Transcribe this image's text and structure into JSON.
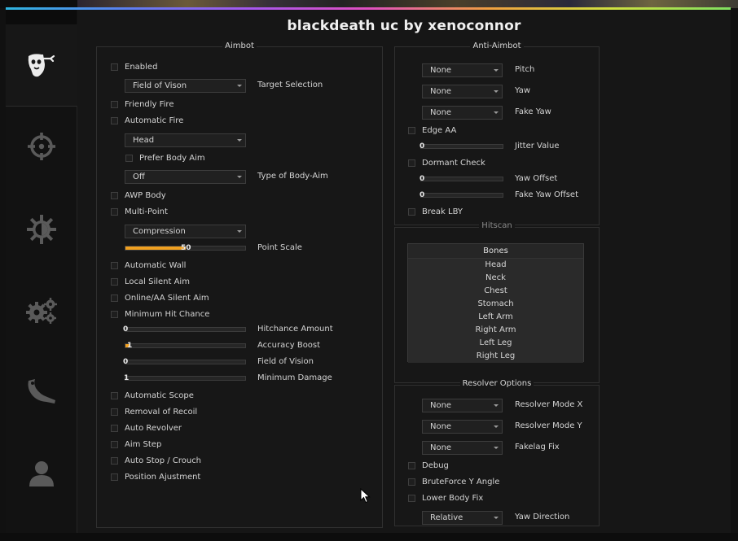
{
  "window": {
    "title": "blackdeath uc by xenoconnor"
  },
  "sidebar": {
    "items": [
      {
        "icon": "ghost-face-icon",
        "active": true
      },
      {
        "icon": "crosshair-icon"
      },
      {
        "icon": "brightness-icon"
      },
      {
        "icon": "gears-icon"
      },
      {
        "icon": "knife-icon"
      },
      {
        "icon": "user-icon"
      }
    ]
  },
  "aimbot": {
    "title": "Aimbot",
    "enabled": "Enabled",
    "target_selection": {
      "value": "Field of Vison",
      "label": "Target Selection"
    },
    "friendly_fire": "Friendly Fire",
    "automatic_fire": "Automatic Fire",
    "hitbox": {
      "value": "Head"
    },
    "prefer_body_aim": "Prefer Body Aim",
    "body_aim_type": {
      "value": "Off",
      "label": "Type of Body-Aim"
    },
    "awp_body": "AWP Body",
    "multi_point": "Multi-Point",
    "multipoint_mode": {
      "value": "Compression"
    },
    "point_scale": {
      "value": "50",
      "label": "Point Scale",
      "fraction": 0.5
    },
    "automatic_wall": "Automatic Wall",
    "local_silent_aim": "Local Silent Aim",
    "online_silent_aim": "Online/AA Silent Aim",
    "minimum_hit_chance": "Minimum Hit Chance",
    "hitchance_amount": {
      "value": "0",
      "label": "Hitchance Amount",
      "fraction": 0
    },
    "accuracy_boost": {
      "value": "1",
      "label": "Accuracy Boost",
      "fraction": 0.04
    },
    "field_of_vision": {
      "value": "0",
      "label": "Field of Vision",
      "fraction": 0
    },
    "minimum_damage": {
      "value": "1",
      "label": "Minimum Damage",
      "fraction": 0
    },
    "automatic_scope": "Automatic Scope",
    "removal_of_recoil": "Removal of Recoil",
    "auto_revolver": "Auto Revolver",
    "aim_step": "Aim Step",
    "auto_stop": "Auto Stop / Crouch",
    "position_adjustment": "Position Ajustment"
  },
  "anti_aimbot": {
    "title": "Anti-Aimbot",
    "pitch": {
      "value": "None",
      "label": "Pitch"
    },
    "yaw": {
      "value": "None",
      "label": "Yaw"
    },
    "fake_yaw": {
      "value": "None",
      "label": "Fake Yaw"
    },
    "edge_aa": "Edge AA",
    "jitter_value": {
      "value": "0",
      "label": "Jitter Value",
      "fraction": 0
    },
    "dormant_check": "Dormant Check",
    "yaw_offset": {
      "value": "0",
      "label": "Yaw Offset",
      "fraction": 0
    },
    "fake_yaw_offset": {
      "value": "0",
      "label": "Fake Yaw Offset",
      "fraction": 0
    },
    "break_lby": "Break LBY"
  },
  "hitscan": {
    "title": "Hitscan",
    "header": "Bones",
    "bones": [
      "Head",
      "Neck",
      "Chest",
      "Stomach",
      "Left Arm",
      "Right Arm",
      "Left Leg",
      "Right Leg"
    ]
  },
  "resolver": {
    "title": "Resolver Options",
    "mode_x": {
      "value": "None",
      "label": "Resolver Mode X"
    },
    "mode_y": {
      "value": "None",
      "label": "Resolver Mode Y"
    },
    "fakelag_fix": {
      "value": "None",
      "label": "Fakelag Fix"
    },
    "debug": "Debug",
    "bruteforce": "BruteForce Y Angle",
    "lower_body_fix": "Lower Body Fix",
    "yaw_direction": {
      "value": "Relative",
      "label": "Yaw Direction"
    }
  },
  "colors": {
    "accent": "#f0a020",
    "background": "#161616",
    "text": "#d4d4d4"
  }
}
